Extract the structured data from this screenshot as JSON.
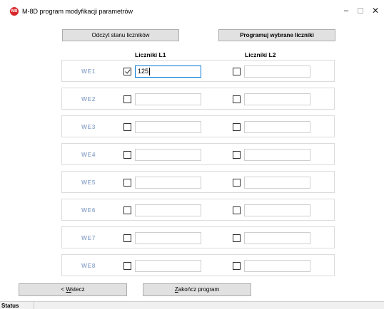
{
  "window": {
    "title": "M-8D program modyfikacji parametrów",
    "icon_text": "M8",
    "minimize_glyph": "–",
    "close_glyph": "✕"
  },
  "toolbar": {
    "read_button": "Odczyt stanu liczników",
    "program_button": "Programuj wybrane liczniki"
  },
  "columns": {
    "l1": "Liczniki L1",
    "l2": "Liczniki L2"
  },
  "rows": [
    {
      "label": "WE1",
      "l1_checked": true,
      "l1_value": "125",
      "l2_checked": false,
      "l2_value": ""
    },
    {
      "label": "WE2",
      "l1_checked": false,
      "l1_value": "",
      "l2_checked": false,
      "l2_value": ""
    },
    {
      "label": "WE3",
      "l1_checked": false,
      "l1_value": "",
      "l2_checked": false,
      "l2_value": ""
    },
    {
      "label": "WE4",
      "l1_checked": false,
      "l1_value": "",
      "l2_checked": false,
      "l2_value": ""
    },
    {
      "label": "WE5",
      "l1_checked": false,
      "l1_value": "",
      "l2_checked": false,
      "l2_value": ""
    },
    {
      "label": "WE6",
      "l1_checked": false,
      "l1_value": "",
      "l2_checked": false,
      "l2_value": ""
    },
    {
      "label": "WE7",
      "l1_checked": false,
      "l1_value": "",
      "l2_checked": false,
      "l2_value": ""
    },
    {
      "label": "WE8",
      "l1_checked": false,
      "l1_value": "",
      "l2_checked": false,
      "l2_value": ""
    }
  ],
  "footer": {
    "back_prefix": "< ",
    "back_accel": "W",
    "back_rest": "stecz",
    "exit_accel": "Z",
    "exit_rest": "akończ program"
  },
  "status": {
    "label": "Status"
  },
  "colors": {
    "row_label": "#9bb0cf",
    "active_border": "#0078d7",
    "button_bg": "#e1e1e1"
  }
}
